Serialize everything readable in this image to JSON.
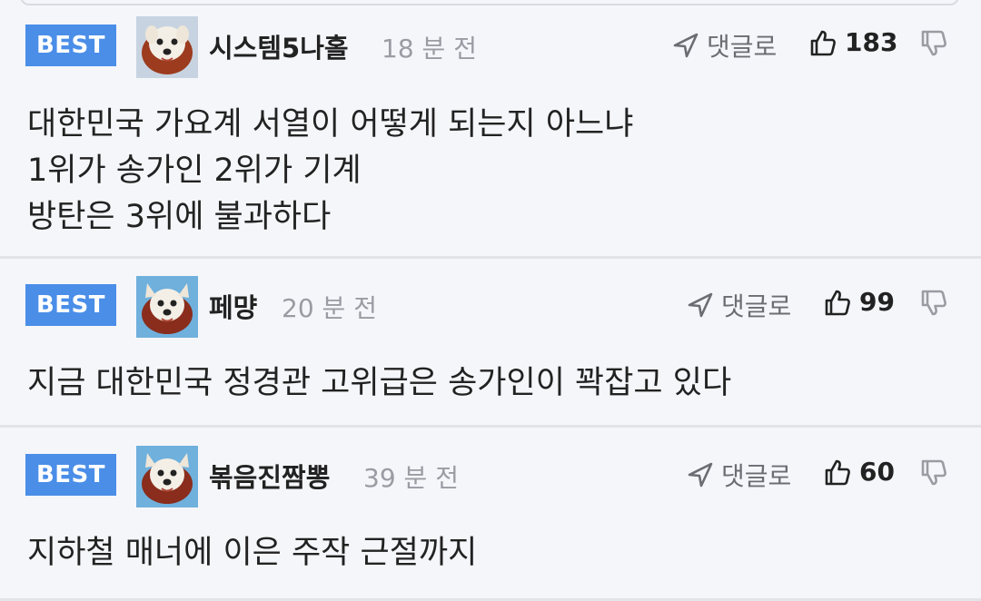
{
  "comments": [
    {
      "badge": "BEST",
      "username": "시스템5나홀",
      "time": "18 분 전",
      "reply_label": "댓글로",
      "likes": "183",
      "lines": [
        "대한민국 가요계 서열이 어떻게 되는지 아느냐",
        "1위가 송가인 2위가 기계",
        "방탄은 3위에 불과하다"
      ]
    },
    {
      "badge": "BEST",
      "username": "페먕",
      "time": "20 분 전",
      "reply_label": "댓글로",
      "likes": "99",
      "lines": [
        "지금 대한민국 정경관 고위급은 송가인이 꽉잡고 있다"
      ]
    },
    {
      "badge": "BEST",
      "username": "볶음진짬뽕",
      "time": "39 분 전",
      "reply_label": "댓글로",
      "likes": "60",
      "lines": [
        "지하철 매너에 이은 주작 근절까지"
      ]
    }
  ],
  "colors": {
    "badge": "#4a8ee8",
    "background": "#f5f6fa",
    "divider": "#e3e4e8",
    "muted_text": "#9a9ca3"
  },
  "icons": {
    "reply": "arrow-send-icon",
    "like": "thumbs-up-icon",
    "dislike": "thumbs-down-icon",
    "avatar": "puppy-avatar"
  }
}
